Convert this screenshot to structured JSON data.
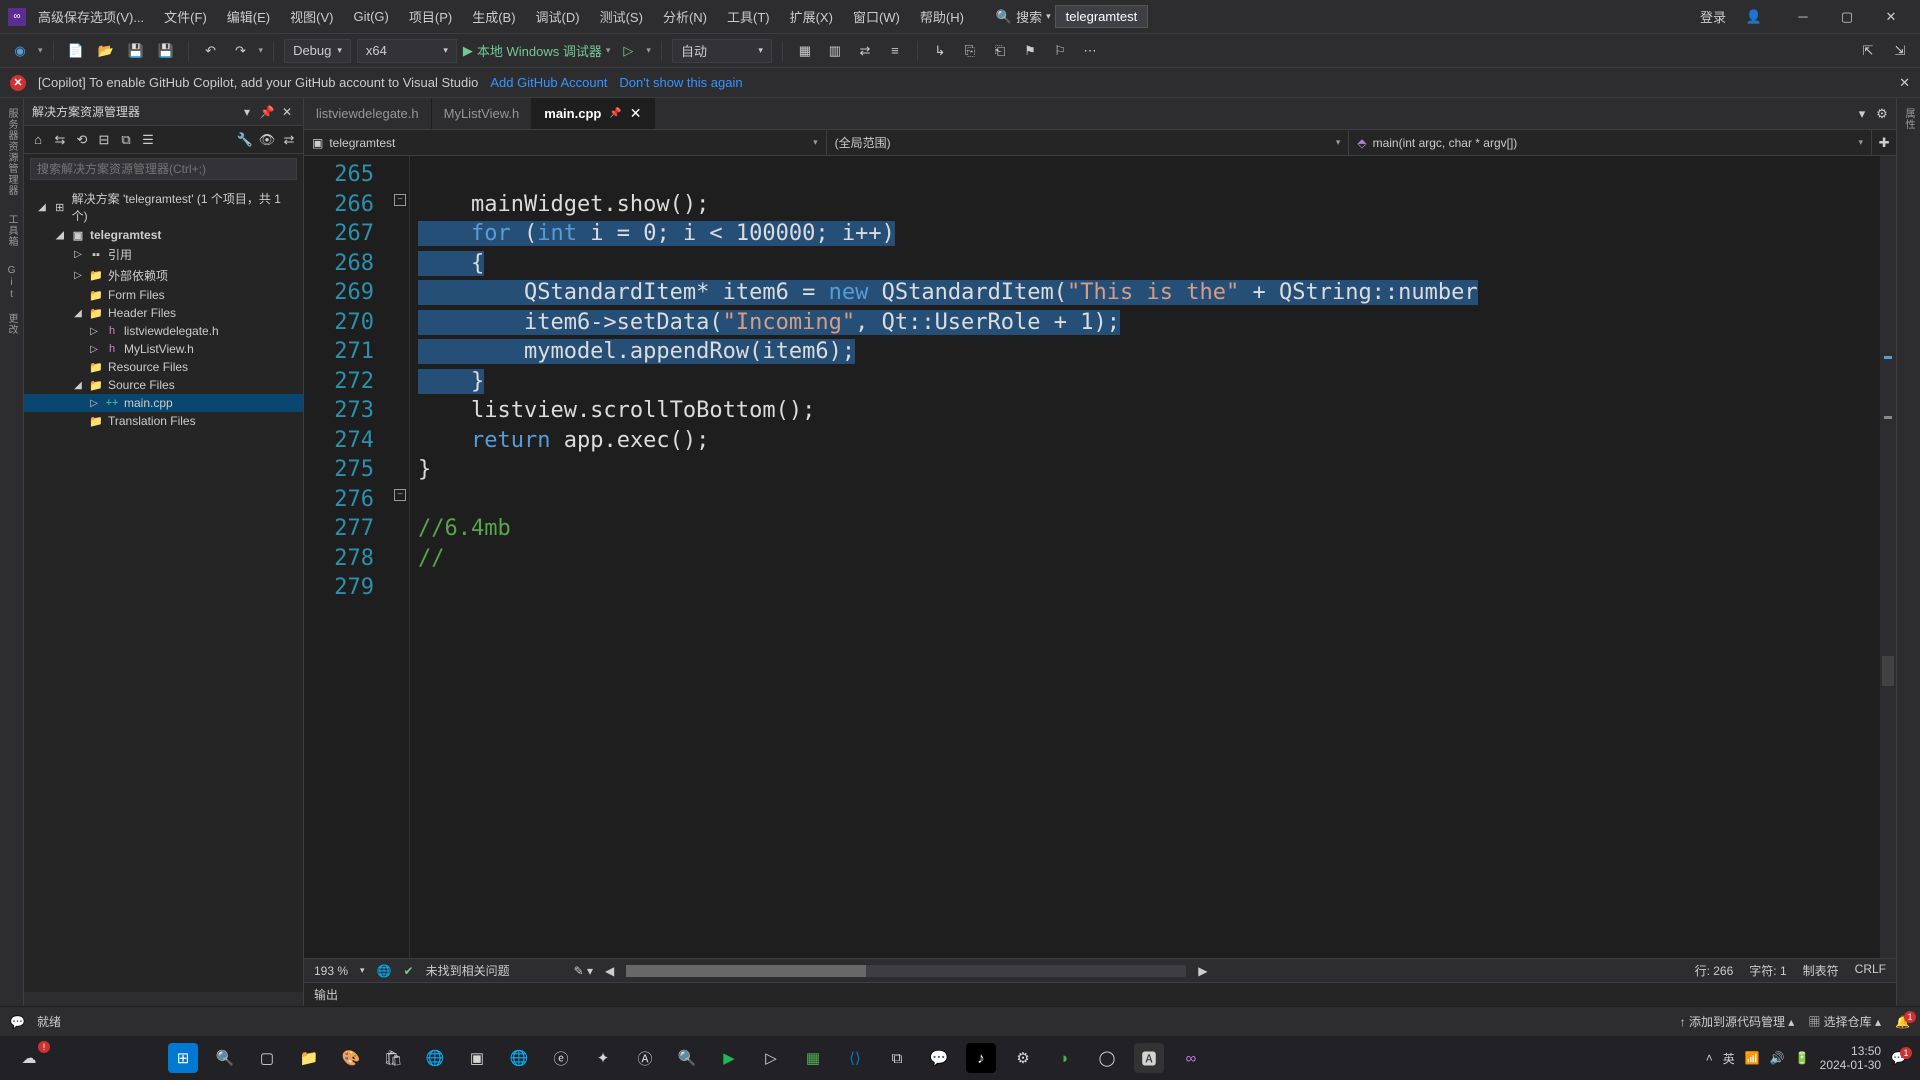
{
  "title_prefix": "高级保存选项(V)...",
  "menus": [
    "文件(F)",
    "编辑(E)",
    "视图(V)",
    "Git(G)",
    "项目(P)",
    "生成(B)",
    "调试(D)",
    "测试(S)",
    "分析(N)",
    "工具(T)",
    "扩展(X)",
    "窗口(W)",
    "帮助(H)"
  ],
  "search_label": "搜索",
  "solution_title": "telegramtest",
  "login": "登录",
  "toolbar": {
    "config": "Debug",
    "platform": "x64",
    "debugger": "本地 Windows 调试器",
    "auto": "自动"
  },
  "infobar": {
    "msg": "[Copilot] To enable GitHub Copilot, add your GitHub account to Visual Studio",
    "link1": "Add GitHub Account",
    "link2": "Don't show this again"
  },
  "rails_left": [
    "服务器资源管理器",
    "工具箱",
    "Git 更改"
  ],
  "rails_right": [
    "属性",
    "通知"
  ],
  "solution": {
    "header": "解决方案资源管理器",
    "search_ph": "搜索解决方案资源管理器(Ctrl+;)",
    "root": "解决方案 'telegramtest' (1 个项目，共 1 个)",
    "project": "telegramtest",
    "folders": {
      "refs": "引用",
      "ext": "外部依赖项",
      "forms": "Form Files",
      "headers": "Header Files",
      "h1": "listviewdelegate.h",
      "h2": "MyListView.h",
      "res": "Resource Files",
      "src": "Source Files",
      "main": "main.cpp",
      "trans": "Translation Files"
    }
  },
  "tabs": [
    {
      "name": "listviewdelegate.h",
      "active": false
    },
    {
      "name": "MyListView.h",
      "active": false
    },
    {
      "name": "main.cpp",
      "active": true
    }
  ],
  "nav": {
    "project": "telegramtest",
    "scope": "(全局范围)",
    "func": "main(int argc, char * argv[])"
  },
  "code": {
    "lines": [
      265,
      266,
      267,
      268,
      269,
      270,
      271,
      272,
      273,
      274,
      275,
      276,
      277,
      278,
      279
    ],
    "c265": "    mainWidget.show();",
    "c266_for": "for",
    "c266_int": "int",
    "c266_rest1": " (",
    "c266_rest2": " i = 0; i < 100000; i++)",
    "c267": "    {",
    "c268_new": "new",
    "c268_a": "        QStandardItem* item6 = ",
    "c268_b": " QStandardItem(",
    "c268_s": "\"This is the\"",
    "c268_c": " + QString::number",
    "c269_a": "        item6->setData(",
    "c269_s": "\"Incoming\"",
    "c269_b": ", Qt::UserRole + 1);",
    "c270": "        mymodel.appendRow(item6);",
    "c271": "    }",
    "c272": "    listview.scrollToBottom();",
    "c273_ret": "return",
    "c273_rest": " app.exec();",
    "c274": "}",
    "c276": "//6.4mb",
    "c277": "//"
  },
  "editor_status": {
    "zoom": "193 %",
    "problems": "未找到相关问题",
    "line": "行: 266",
    "col": "字符: 1",
    "tabs": "制表符",
    "eol": "CRLF"
  },
  "output_label": "输出",
  "statusbar": {
    "ready": "就绪",
    "srcctl": "添加到源代码管理",
    "repo": "选择仓库"
  },
  "taskbar": {
    "lang": "英",
    "time": "13:50",
    "date": "2024-01-30"
  }
}
